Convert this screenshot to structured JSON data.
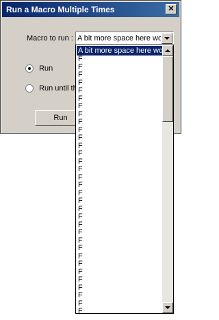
{
  "dialog": {
    "title": "Run a Macro Multiple Times",
    "close_glyph": "✕",
    "macro_label": "Macro to run :",
    "macro_value": "A bit more space here wo",
    "radio_run_label": "Run",
    "radio_until_label": "Run until the",
    "run_button": "Run"
  },
  "dropdown": {
    "items": [
      "A bit more space here wo",
      "F",
      "F",
      "F",
      "F",
      "F",
      "F",
      "F",
      "F",
      "F",
      "F",
      "F",
      "F",
      "F",
      "F",
      "F",
      "F",
      "F",
      "F",
      "F",
      "F",
      "F",
      "F",
      "F",
      "F",
      "F",
      "F",
      "F",
      "F",
      "F",
      "F",
      "F",
      "F",
      "F",
      "F"
    ]
  }
}
